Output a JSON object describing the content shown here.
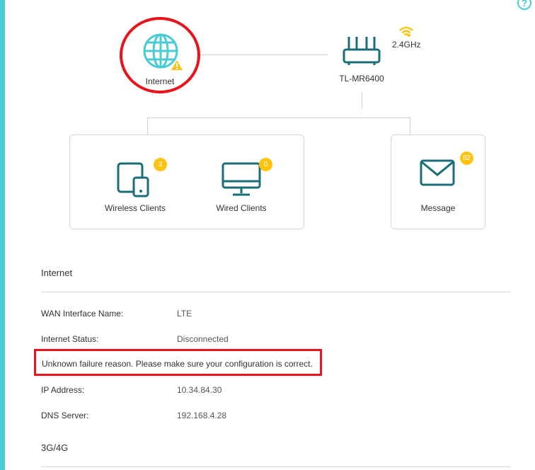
{
  "help": {
    "label": "?"
  },
  "topology": {
    "internet_label": "Internet",
    "router_label": "TL-MR6400",
    "band_label": "2.4GHz"
  },
  "clients": {
    "wireless": {
      "label": "Wireless Clients",
      "count": "3"
    },
    "wired": {
      "label": "Wired Clients",
      "count": "0"
    },
    "message": {
      "label": "Message",
      "count": "82"
    }
  },
  "internet_section": {
    "title": "Internet",
    "wan_label": "WAN Interface Name:",
    "wan_value": "LTE",
    "status_label": "Internet Status:",
    "status_value": "Disconnected",
    "error_message": "Unknown failure reason. Please make sure your configuration is correct.",
    "ip_label": "IP Address:",
    "ip_value": "10.34.84.30",
    "dns_label": "DNS Server:",
    "dns_value": "192.168.4.28"
  },
  "section_3g4g": {
    "title": "3G/4G"
  },
  "colors": {
    "accent": "#4acbd6",
    "icon_teal": "#1a6e78",
    "warning": "#ffc20e",
    "highlight_red": "#e8131b"
  }
}
